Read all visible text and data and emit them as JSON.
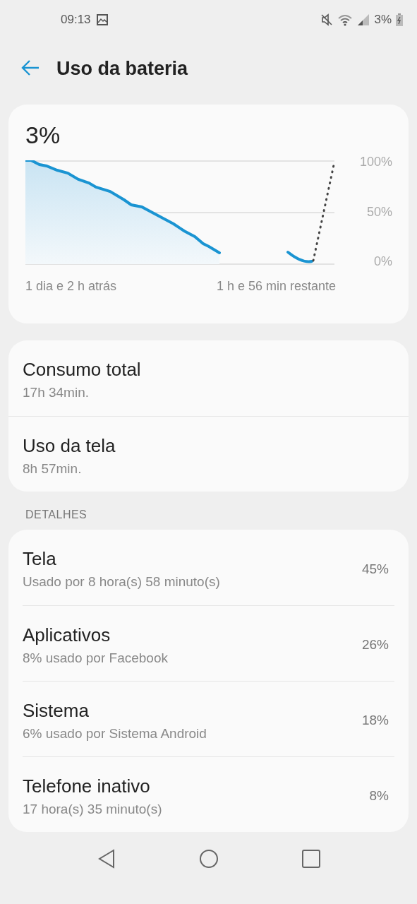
{
  "status_bar": {
    "time": "09:13",
    "battery": "3%"
  },
  "header": {
    "title": "Uso da bateria"
  },
  "battery_card": {
    "level_text": "3%",
    "y_labels": [
      "100%",
      "50%",
      "0%"
    ],
    "start_label": "1 dia e 2 h atrás",
    "end_label": "1 h e 56 min restante"
  },
  "summary": [
    {
      "title": "Consumo total",
      "value": "17h 34min."
    },
    {
      "title": "Uso da tela",
      "value": "8h 57min."
    }
  ],
  "details": {
    "heading": "DETALHES",
    "items": [
      {
        "title": "Tela",
        "subtitle": "Usado por 8 hora(s) 58 minuto(s)",
        "percent": "45%"
      },
      {
        "title": "Aplicativos",
        "subtitle": "8% usado por Facebook",
        "percent": "26%"
      },
      {
        "title": "Sistema",
        "subtitle": "6% usado por Sistema Android",
        "percent": "18%"
      },
      {
        "title": "Telefone inativo",
        "subtitle": "17 hora(s) 35 minuto(s)",
        "percent": "8%"
      }
    ]
  }
}
